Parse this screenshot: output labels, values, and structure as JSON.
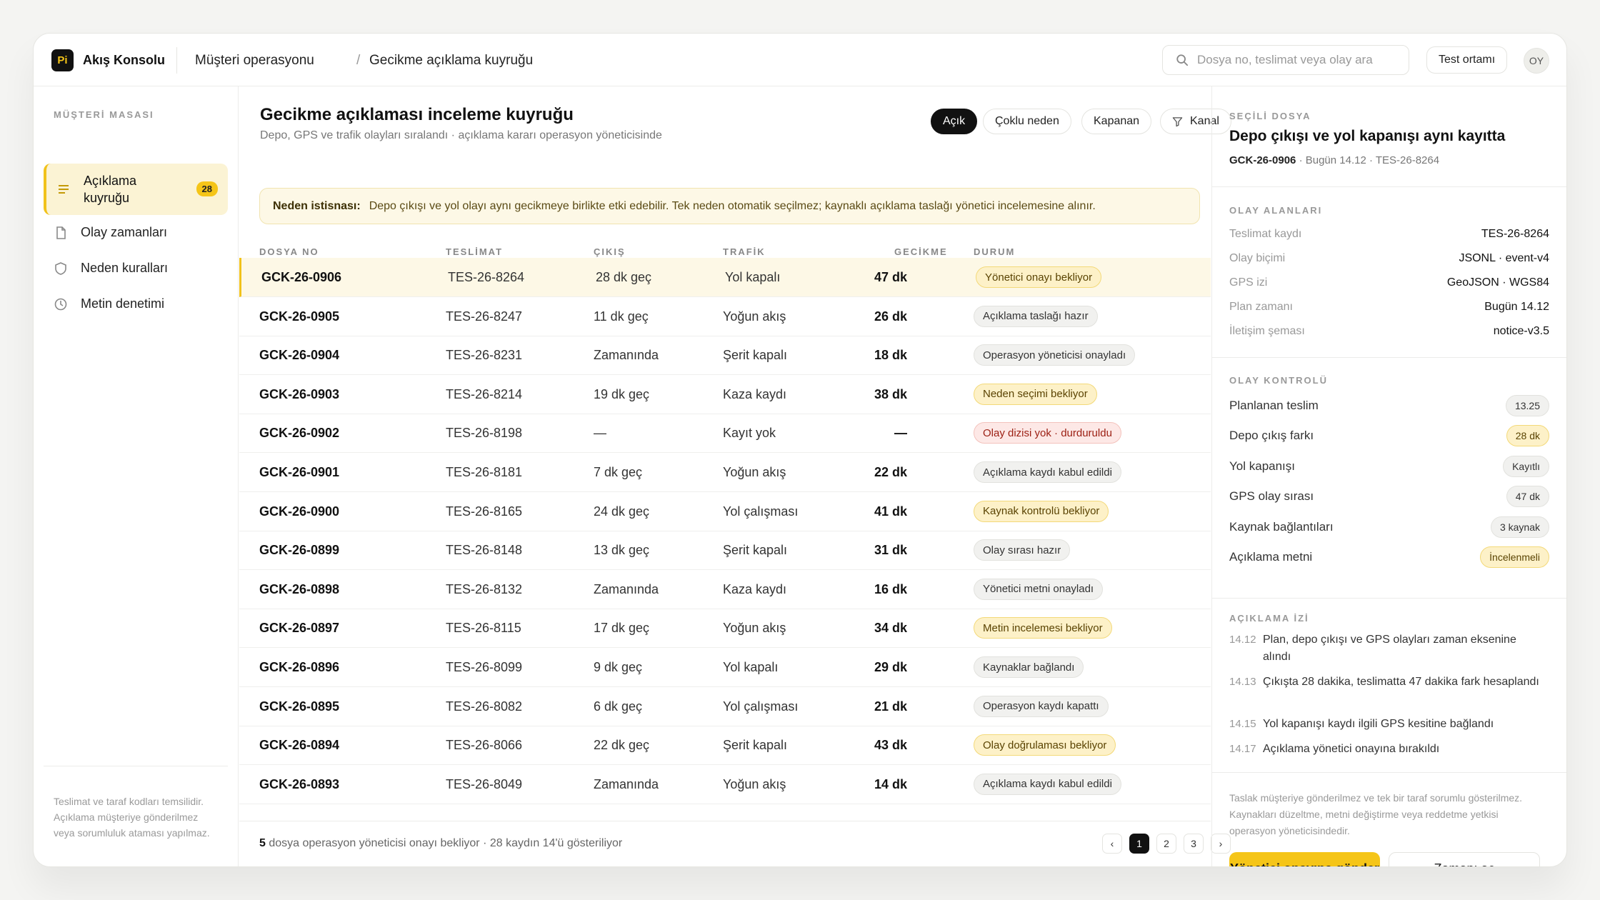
{
  "header": {
    "logo_text": "Pi",
    "app_name": "Akış Konsolu",
    "breadcrumb": [
      "Müşteri operasyonu",
      "Gecikme açıklama kuyruğu"
    ],
    "breadcrumb_sep": "/",
    "search_placeholder": "Dosya no, teslimat veya olay ara",
    "env_label": "Test ortamı",
    "avatar": "OY"
  },
  "sidebar": {
    "title": "MÜŞTERİ MASASI",
    "items": [
      {
        "label": "Açıklama kuyruğu",
        "badge": "28",
        "icon": "list-icon"
      },
      {
        "label": "Olay zamanları",
        "icon": "document-icon"
      },
      {
        "label": "Neden kuralları",
        "icon": "shield-icon"
      },
      {
        "label": "Metin denetimi",
        "icon": "clock-icon"
      }
    ],
    "footer": "Teslimat ve taraf kodları temsilidir. Açıklama müşteriye gönderilmez veya sorumluluk ataması yapılmaz."
  },
  "main": {
    "title": "Gecikme açıklaması inceleme kuyruğu",
    "subtitle": "Depo, GPS ve trafik olayları sıralandı · açıklama kararı operasyon yöneticisinde",
    "filters": [
      "Açık",
      "Çoklu neden",
      "Kapanan",
      "Kanal"
    ],
    "notice_label": "Neden istisnası:",
    "notice_text": "Depo çıkışı ve yol olayı aynı gecikmeye birlikte etki edebilir. Tek neden otomatik seçilmez; kaynaklı açıklama taslağı yönetici incelemesine alınır.",
    "columns": [
      "DOSYA NO",
      "TESLİMAT",
      "ÇIKIŞ",
      "TRAFİK",
      "GECİKME",
      "DURUM"
    ],
    "rows": [
      {
        "id": "GCK-26-0906",
        "tes": "TES-26-8264",
        "cik": "28 dk geç",
        "traf": "Yol kapalı",
        "gec": "47 dk",
        "status": "Yönetici onayı bekliyor",
        "tone": "yellow"
      },
      {
        "id": "GCK-26-0905",
        "tes": "TES-26-8247",
        "cik": "11 dk geç",
        "traf": "Yoğun akış",
        "gec": "26 dk",
        "status": "Açıklama taslağı hazır",
        "tone": "gray"
      },
      {
        "id": "GCK-26-0904",
        "tes": "TES-26-8231",
        "cik": "Zamanında",
        "traf": "Şerit kapalı",
        "gec": "18 dk",
        "status": "Operasyon yöneticisi onayladı",
        "tone": "gray"
      },
      {
        "id": "GCK-26-0903",
        "tes": "TES-26-8214",
        "cik": "19 dk geç",
        "traf": "Kaza kaydı",
        "gec": "38 dk",
        "status": "Neden seçimi bekliyor",
        "tone": "yellow"
      },
      {
        "id": "GCK-26-0902",
        "tes": "TES-26-8198",
        "cik": "—",
        "traf": "Kayıt yok",
        "gec": "—",
        "status": "Olay dizisi yok · durduruldu",
        "tone": "red"
      },
      {
        "id": "GCK-26-0901",
        "tes": "TES-26-8181",
        "cik": "7 dk geç",
        "traf": "Yoğun akış",
        "gec": "22 dk",
        "status": "Açıklama kaydı kabul edildi",
        "tone": "gray"
      },
      {
        "id": "GCK-26-0900",
        "tes": "TES-26-8165",
        "cik": "24 dk geç",
        "traf": "Yol çalışması",
        "gec": "41 dk",
        "status": "Kaynak kontrolü bekliyor",
        "tone": "yellow"
      },
      {
        "id": "GCK-26-0899",
        "tes": "TES-26-8148",
        "cik": "13 dk geç",
        "traf": "Şerit kapalı",
        "gec": "31 dk",
        "status": "Olay sırası hazır",
        "tone": "gray"
      },
      {
        "id": "GCK-26-0898",
        "tes": "TES-26-8132",
        "cik": "Zamanında",
        "traf": "Kaza kaydı",
        "gec": "16 dk",
        "status": "Yönetici metni onayladı",
        "tone": "gray"
      },
      {
        "id": "GCK-26-0897",
        "tes": "TES-26-8115",
        "cik": "17 dk geç",
        "traf": "Yoğun akış",
        "gec": "34 dk",
        "status": "Metin incelemesi bekliyor",
        "tone": "yellow"
      },
      {
        "id": "GCK-26-0896",
        "tes": "TES-26-8099",
        "cik": "9 dk geç",
        "traf": "Yol kapalı",
        "gec": "29 dk",
        "status": "Kaynaklar bağlandı",
        "tone": "gray"
      },
      {
        "id": "GCK-26-0895",
        "tes": "TES-26-8082",
        "cik": "6 dk geç",
        "traf": "Yol çalışması",
        "gec": "21 dk",
        "status": "Operasyon kaydı kapattı",
        "tone": "gray"
      },
      {
        "id": "GCK-26-0894",
        "tes": "TES-26-8066",
        "cik": "22 dk geç",
        "traf": "Şerit kapalı",
        "gec": "43 dk",
        "status": "Olay doğrulaması bekliyor",
        "tone": "yellow"
      },
      {
        "id": "GCK-26-0893",
        "tes": "TES-26-8049",
        "cik": "Zamanında",
        "traf": "Yoğun akış",
        "gec": "14 dk",
        "status": "Açıklama kaydı kabul edildi",
        "tone": "gray"
      }
    ],
    "footer_count": "5",
    "footer_text": " dosya operasyon yöneticisi onayı bekliyor · 28 kaydın 14'ü gösteriliyor",
    "pages": [
      "‹",
      "1",
      "2",
      "3",
      "›"
    ],
    "current_page": "1"
  },
  "panel": {
    "section_selected": "SEÇİLİ DOSYA",
    "title": "Depo çıkışı ve yol kapanışı aynı kayıtta",
    "meta_id": "GCK-26-0906",
    "meta_rest": "·  Bugün 14.12 · TES-26-8264",
    "section_fields": "OLAY ALANLARI",
    "fields": [
      {
        "k": "Teslimat kaydı",
        "v": "TES-26-8264"
      },
      {
        "k": "Olay biçimi",
        "v": "JSONL · event-v4"
      },
      {
        "k": "GPS izi",
        "v": "GeoJSON · WGS84"
      },
      {
        "k": "Plan zamanı",
        "v": "Bugün 14.12"
      },
      {
        "k": "İletişim şeması",
        "v": "notice-v3.5"
      }
    ],
    "section_checks": "OLAY KONTROLÜ",
    "checks": [
      {
        "k": "Planlanan teslim",
        "v": "13.25",
        "tone": "gray"
      },
      {
        "k": "Depo çıkış farkı",
        "v": "28 dk",
        "tone": "yellow"
      },
      {
        "k": "Yol kapanışı",
        "v": "Kayıtlı",
        "tone": "gray"
      },
      {
        "k": "GPS olay sırası",
        "v": "47 dk",
        "tone": "gray"
      },
      {
        "k": "Kaynak bağlantıları",
        "v": "3 kaynak",
        "tone": "gray"
      },
      {
        "k": "Açıklama metni",
        "v": "İncelenmeli",
        "tone": "yellow"
      }
    ],
    "section_log": "AÇIKLAMA İZİ",
    "log": [
      {
        "t": "14.12",
        "text": "Plan, depo çıkışı ve GPS olayları zaman eksenine alındı"
      },
      {
        "t": "14.13",
        "text": "Çıkışta 28 dakika, teslimatta 47 dakika fark hesaplandı"
      },
      {
        "t": "14.15",
        "text": "Yol kapanışı kaydı ilgili GPS kesitine bağlandı"
      },
      {
        "t": "14.17",
        "text": "Açıklama yönetici onayına bırakıldı"
      }
    ],
    "footer_note": "Taslak müşteriye gönderilmez ve tek bir taraf sorumlu gösterilmez. Kaynakları düzeltme, metni değiştirme veya reddetme yetkisi operasyon yöneticisindedir.",
    "primary_button": "Yönetici onayına gönder",
    "secondary_button": "Zamanı aç"
  },
  "colors": {
    "accent": "#f5c518",
    "dark": "#111111",
    "status_yellow_bg": "#fdf1c8",
    "status_red_bg": "#fde8e6",
    "status_gray_bg": "#f1f1ef"
  }
}
